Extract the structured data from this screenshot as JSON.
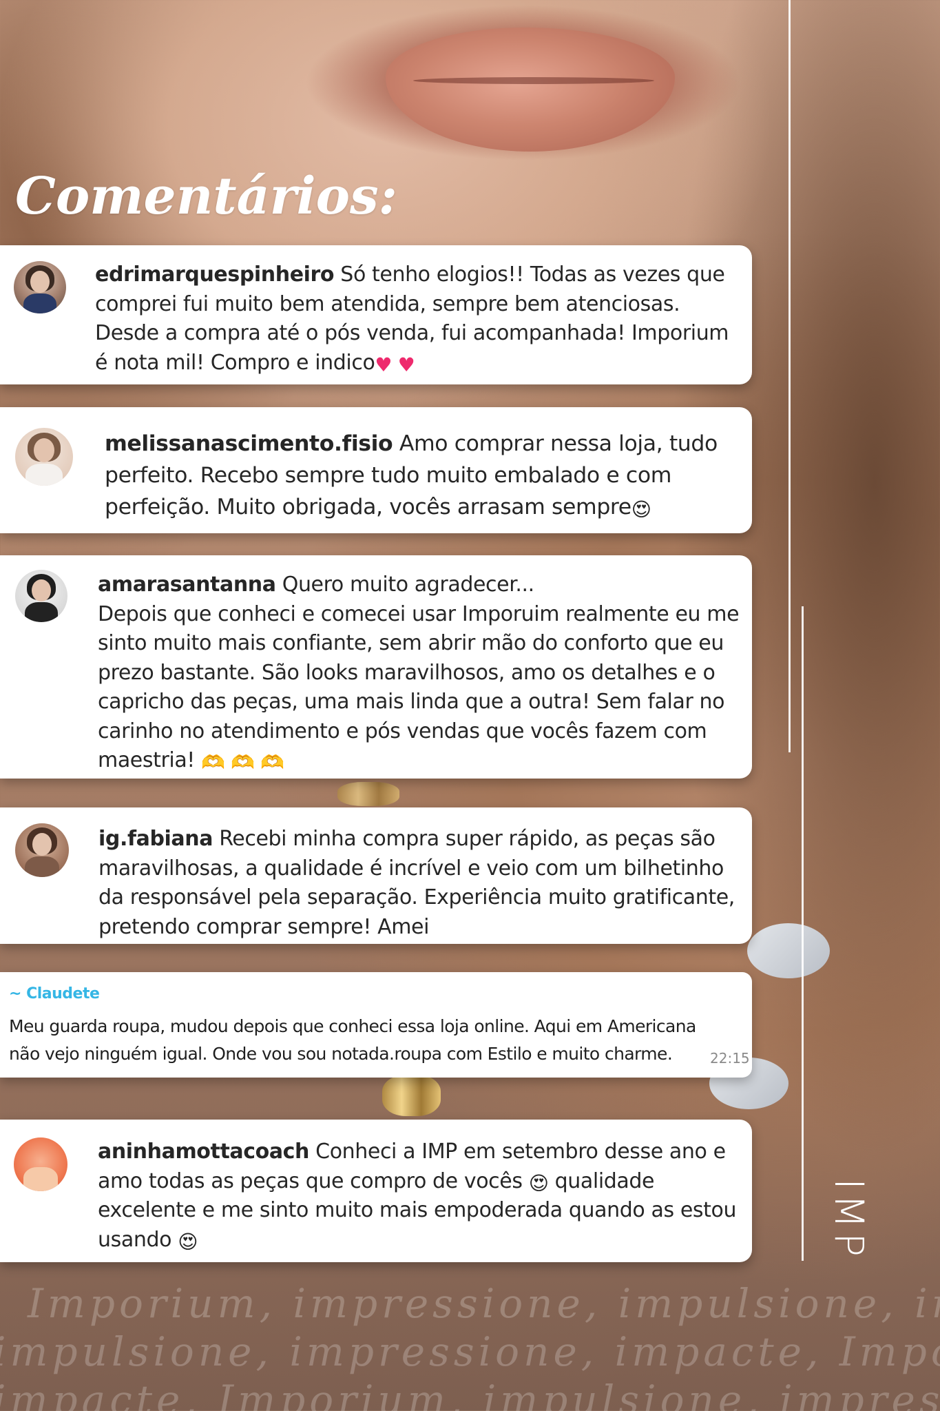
{
  "title": "Comentários:",
  "comments": [
    {
      "user": "edrimarquespinheiro",
      "lines": [
        "Só tenho elogios!! Todas as vezes que",
        "comprei fui muito bem atendida, sempre bem atenciosas.",
        "Desde a compra até o pós venda, fui acompanhada! Imporium",
        "é nota mil! Compro e indico"
      ],
      "emoji": "♥ ♥"
    },
    {
      "user": "melissanascimento.fisio",
      "lines": [
        "Amo comprar nessa loja, tudo",
        "perfeito. Recebo sempre tudo muito embalado e com",
        "perfeição. Muito obrigada, vocês arrasam sempre"
      ],
      "emoji": "😍"
    },
    {
      "user": "amarasantanna",
      "lines": [
        "Quero muito agradecer...",
        "Depois que conheci e comecei usar Imporuim realmente eu me",
        "sinto muito mais confiante, sem abrir mão do conforto que eu",
        "prezo bastante. São looks maravilhosos, amo os detalhes e o",
        "capricho das peças, uma mais linda que a outra! Sem falar no",
        "carinho no atendimento e pós vendas que vocês fazem com",
        "maestria!"
      ],
      "emoji": "🫶 🫶 🫶"
    },
    {
      "user": "ig.fabiana",
      "lines": [
        "Recebi minha compra super rápido, as peças são",
        "maravilhosas, a qualidade é incrível e veio com um bilhetinho",
        "da responsável pela separação. Experiência muito gratificante,",
        "pretendo comprar sempre! Amei"
      ]
    },
    {
      "user": "~ Claudete",
      "lines": [
        "Meu guarda roupa, mudou depois que conheci essa loja online. Aqui em Americana",
        "não vejo ninguém igual. Onde vou sou notada.roupa com Estilo e muito charme."
      ],
      "time": "22:15"
    },
    {
      "user": "aninhamottacoach",
      "lines": [
        "Conheci a IMP em setembro desse ano e",
        "amo todas as peças que compro de vocês",
        "qualidade",
        "excelente e me sinto muito mais empoderada quando as estou",
        "usando"
      ],
      "emoji": "😍"
    }
  ],
  "brand": "IMP",
  "watermark_lines": [
    "Imporium, impressione, impulsione, impacte,",
    "impulsione, impressione, impacte, Imporium,",
    "impacte, Imporium, impulsione, impressione, I"
  ],
  "colors": {
    "card": "#ffffff",
    "text": "#262626",
    "whatsapp_name": "#35b6e5",
    "heart": "#ee2a6d"
  }
}
